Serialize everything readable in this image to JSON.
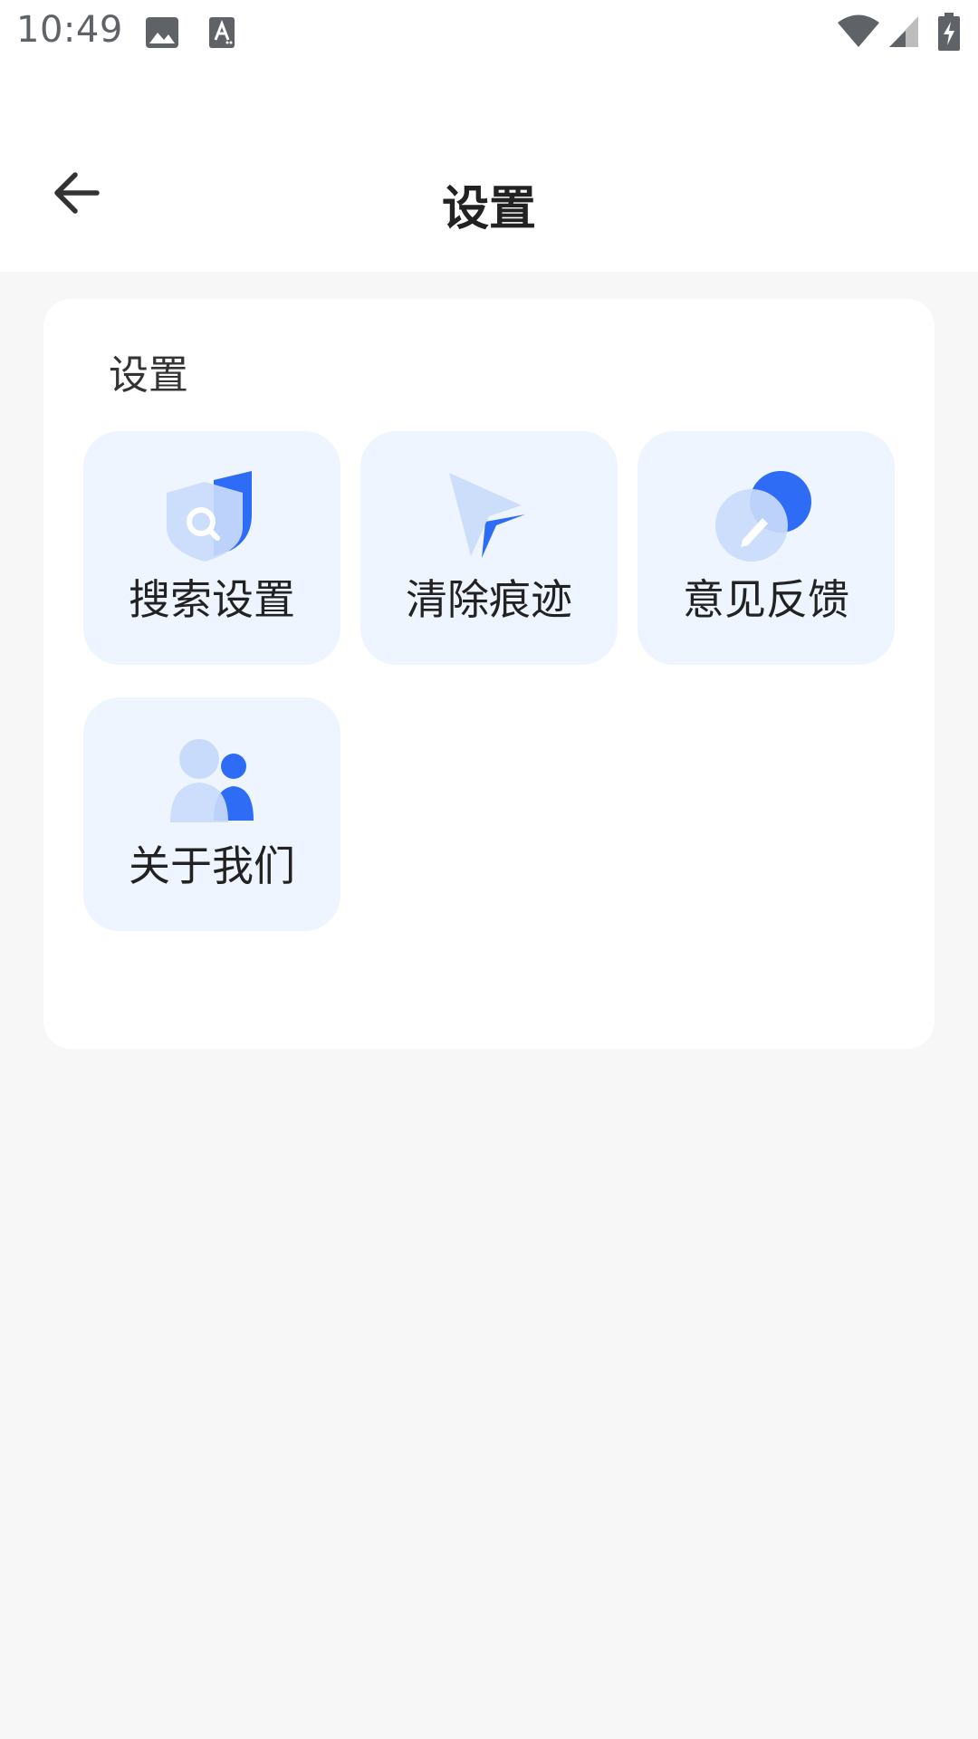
{
  "status_bar": {
    "time": "10:49",
    "icons": [
      "image-icon",
      "text-recognition-icon",
      "wifi-icon",
      "signal-icon",
      "battery-charging-icon"
    ]
  },
  "header": {
    "back_icon": "arrow-left-icon",
    "title": "设置"
  },
  "card": {
    "section_title": "设置",
    "items": [
      {
        "label": "搜索设置",
        "icon": "shield-search-icon"
      },
      {
        "label": "清除痕迹",
        "icon": "cursor-arrow-icon"
      },
      {
        "label": "意见反馈",
        "icon": "feedback-edit-icon"
      },
      {
        "label": "关于我们",
        "icon": "people-icon"
      }
    ]
  },
  "colors": {
    "accent_blue": "#2f6cf6",
    "light_blue": "#c9dbfb",
    "tile_bg": "#eef5ff",
    "page_bg": "#f7f7f8"
  }
}
